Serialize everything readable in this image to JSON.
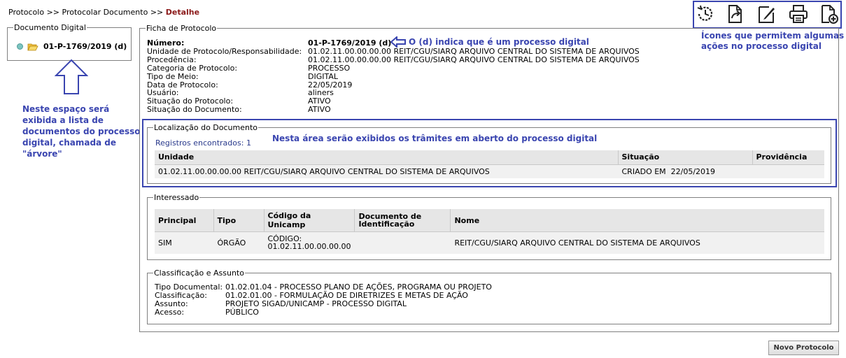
{
  "breadcrumb": {
    "item1": "Protocolo",
    "sep": ">>",
    "item2": "Protocolar Documento",
    "current": "Detalhe"
  },
  "tree": {
    "legend": "Documento Digital",
    "item": "01-P-1769/2019 (d)"
  },
  "ficha": {
    "legend": "Ficha de Protocolo",
    "rows": [
      {
        "label": "Número:",
        "value": "01-P-1769/2019 (d)"
      },
      {
        "label": "Unidade de Protocolo/Responsabilidade:",
        "value": "01.02.11.00.00.00.00 REIT/CGU/SIARQ ARQUIVO CENTRAL DO SISTEMA DE ARQUIVOS"
      },
      {
        "label": "Procedência:",
        "value": "01.02.11.00.00.00.00 REIT/CGU/SIARQ ARQUIVO CENTRAL DO SISTEMA DE ARQUIVOS"
      },
      {
        "label": "Categoria de Protocolo:",
        "value": "PROCESSO"
      },
      {
        "label": "Tipo de Meio:",
        "value": "DIGITAL"
      },
      {
        "label": "Data de Protocolo:",
        "value": "22/05/2019"
      },
      {
        "label": "Usuário:",
        "value": "aliners"
      },
      {
        "label": "Situação do Protocolo:",
        "value": "ATIVO"
      },
      {
        "label": "Situação do Documento:",
        "value": "ATIVO"
      }
    ]
  },
  "localizacao": {
    "legend": "Localização do Documento",
    "registros": "Registros encontrados: 1",
    "headers": [
      "Unidade",
      "Situação",
      "Providência"
    ],
    "row": [
      "01.02.11.00.00.00.00 REIT/CGU/SIARQ ARQUIVO CENTRAL DO SISTEMA DE ARQUIVOS",
      "CRIADO EM  22/05/2019",
      ""
    ]
  },
  "interessado": {
    "legend": "Interessado",
    "headers": [
      "Principal",
      "Tipo",
      "Código da Unicamp",
      "Documento de Identificação",
      "Nome"
    ],
    "row": [
      "SIM",
      "ÓRGÃO",
      "CÓDIGO: 01.02.11.00.00.00.00",
      "",
      "REIT/CGU/SIARQ ARQUIVO CENTRAL DO SISTEMA DE ARQUIVOS"
    ]
  },
  "classificacao": {
    "legend": "Classificação e Assunto",
    "rows": [
      {
        "label": "Tipo Documental:",
        "value": "01.02.01.04 - PROCESSO PLANO DE AÇÕES, PROGRAMA OU PROJETO"
      },
      {
        "label": "Classificação:",
        "value": "01.02.01.00 - FORMULAÇÃO DE DIRETRIZES E METAS DE AÇÃO"
      },
      {
        "label": "Assunto:",
        "value": "PROJETO SIGAD/UNICAMP - PROCESSO DIGITAL"
      },
      {
        "label": "Acesso:",
        "value": "PÚBLICO"
      }
    ]
  },
  "annotations": {
    "digital": "O (d) indica que é um processo digital",
    "icons_line1": "Ícones que permitem algumas",
    "icons_line2": "ações no processo digital",
    "tramites": "Nesta área serão exibidos os trâmites em aberto do processo digital",
    "tree_lines": [
      "Neste espaço será",
      "exibida a lista de",
      "documentos do processo",
      "digital, chamada de",
      "\"árvore\""
    ]
  },
  "toolbar_icons": [
    "clock-history-icon",
    "document-arrow-icon",
    "edit-pencil-icon",
    "printer-icon",
    "add-document-icon"
  ],
  "colors": {
    "annotation": "#3a45b0",
    "breadcrumb_current": "#8b1a1a"
  },
  "button": {
    "label": "Novo Protocolo"
  }
}
